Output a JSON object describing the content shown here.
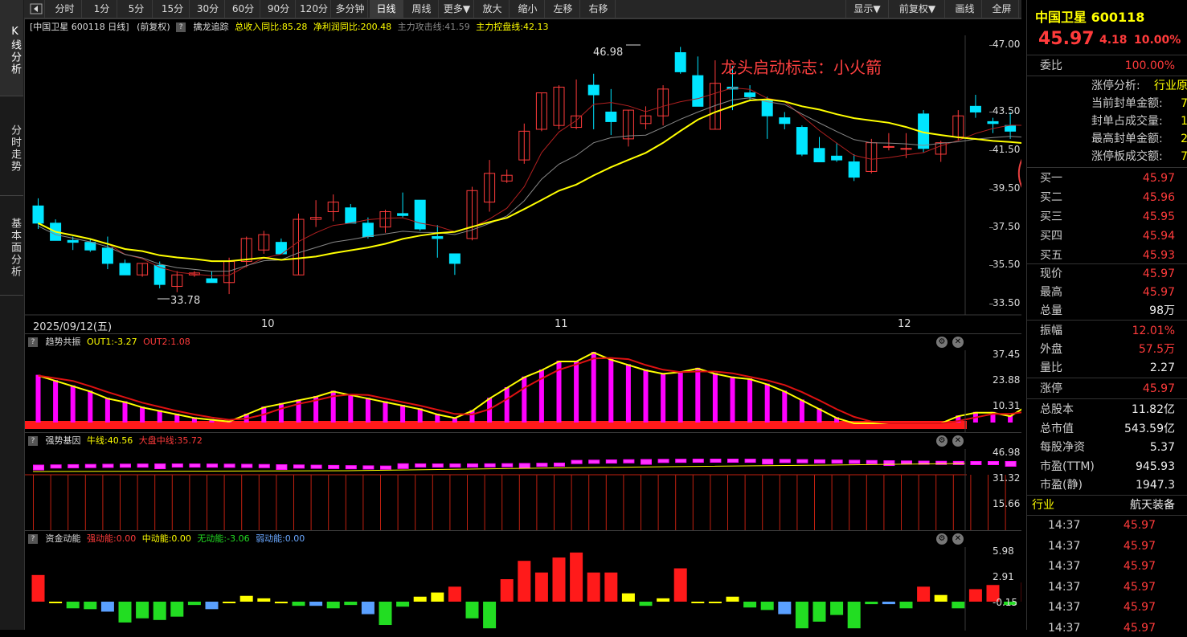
{
  "vtabs": [
    "K线分析",
    "分时走势",
    "基本面分析"
  ],
  "toolbar": {
    "back_icon": "back-arrow-icon",
    "buttons": [
      "分时",
      "1分",
      "5分",
      "15分",
      "30分",
      "60分",
      "90分",
      "120分",
      "多分钟",
      "日线",
      "周线",
      "更多▼",
      "放大",
      "缩小",
      "左移",
      "右移"
    ],
    "right_buttons": [
      "显示▼",
      "前复权▼",
      "画线",
      "全屏"
    ],
    "active": "日线"
  },
  "main": {
    "header": {
      "name": "[中国卫星 600118 日线]",
      "adj": "(前复权)",
      "indicator": "擒龙追踪",
      "items": [
        {
          "label": "总收入同比:85.28",
          "color": "#ffff00"
        },
        {
          "label": "净利润同比:200.48",
          "color": "#ffff00"
        },
        {
          "label": "主力攻击线:41.59",
          "color": "#888888"
        },
        {
          "label": "主力控盘线:42.13",
          "color": "#ffff00"
        }
      ]
    },
    "y_ticks": [
      "47.00",
      "43.50",
      "41.50",
      "39.50",
      "37.50",
      "35.50",
      "33.50"
    ],
    "x_labels": [
      "2025/09/12(五)",
      "10",
      "11",
      "12"
    ],
    "annotation": "龙头启动标志：小火箭",
    "high_label": "46.98",
    "low_label": "33.78",
    "rocket_icon": "rocket-icon"
  },
  "chart_data": [
    {
      "type": "candlestick",
      "title": "中国卫星 600118 日线",
      "ylim": [
        33.5,
        47.0
      ],
      "ohlc": [
        [
          38.6,
          39.0,
          37.4,
          37.7
        ],
        [
          37.7,
          37.9,
          36.8,
          36.8
        ],
        [
          36.8,
          37.0,
          36.3,
          36.7
        ],
        [
          36.7,
          36.9,
          36.2,
          36.3
        ],
        [
          36.4,
          37.0,
          35.3,
          35.6
        ],
        [
          35.6,
          35.8,
          35.0,
          35.0
        ],
        [
          35.0,
          35.6,
          34.9,
          35.6
        ],
        [
          35.5,
          35.7,
          34.3,
          34.5
        ],
        [
          34.4,
          35.2,
          34.1,
          35.0
        ],
        [
          35.0,
          35.2,
          34.9,
          35.1
        ],
        [
          34.8,
          35.2,
          34.6,
          34.6
        ],
        [
          34.6,
          35.9,
          34.0,
          35.7
        ],
        [
          35.7,
          37.0,
          35.4,
          36.9
        ],
        [
          36.3,
          37.3,
          36.1,
          37.1
        ],
        [
          36.7,
          36.9,
          36.1,
          36.1
        ],
        [
          35.0,
          38.2,
          35.0,
          37.9
        ],
        [
          37.9,
          38.9,
          37.5,
          38.0
        ],
        [
          38.3,
          39.2,
          37.8,
          38.8
        ],
        [
          38.5,
          38.7,
          37.7,
          37.7
        ],
        [
          37.7,
          38.0,
          36.9,
          37.0
        ],
        [
          37.5,
          38.4,
          37.2,
          38.3
        ],
        [
          38.2,
          39.3,
          38.0,
          38.1
        ],
        [
          38.9,
          38.9,
          37.3,
          37.4
        ],
        [
          37.0,
          37.6,
          35.9,
          36.9
        ],
        [
          36.1,
          36.1,
          35.0,
          35.6
        ],
        [
          36.9,
          39.6,
          36.8,
          39.4
        ],
        [
          38.8,
          41.0,
          38.3,
          40.3
        ],
        [
          39.9,
          40.5,
          39.8,
          40.2
        ],
        [
          41.0,
          42.9,
          40.8,
          42.5
        ],
        [
          42.6,
          44.5,
          42.5,
          44.5
        ],
        [
          42.8,
          44.9,
          42.6,
          44.8
        ],
        [
          42.7,
          45.2,
          42.6,
          43.3
        ],
        [
          44.9,
          45.5,
          42.6,
          44.4
        ],
        [
          43.5,
          44.7,
          42.3,
          43.0
        ],
        [
          42.1,
          43.6,
          41.7,
          43.6
        ],
        [
          42.9,
          43.8,
          42.6,
          43.3
        ],
        [
          43.3,
          44.9,
          42.8,
          44.7
        ],
        [
          46.6,
          46.9,
          45.5,
          45.6
        ],
        [
          45.4,
          46.4,
          43.8,
          43.8
        ],
        [
          42.6,
          46.2,
          42.6,
          45.0
        ],
        [
          44.8,
          45.9,
          43.6,
          44.7
        ],
        [
          44.5,
          44.9,
          44.1,
          44.3
        ],
        [
          44.1,
          44.3,
          42.1,
          43.3
        ],
        [
          43.2,
          43.5,
          42.6,
          42.9
        ],
        [
          42.7,
          42.8,
          41.2,
          41.3
        ],
        [
          41.6,
          42.2,
          40.9,
          40.9
        ],
        [
          41.2,
          41.9,
          40.9,
          41.0
        ],
        [
          40.9,
          41.3,
          39.9,
          40.1
        ],
        [
          40.4,
          42.1,
          40.3,
          41.9
        ],
        [
          41.7,
          42.4,
          41.5,
          41.7
        ],
        [
          41.6,
          42.4,
          41.1,
          41.6
        ],
        [
          43.4,
          43.6,
          41.4,
          41.6
        ],
        [
          41.3,
          42.0,
          40.9,
          41.9
        ],
        [
          42.2,
          43.6,
          42.0,
          43.3
        ],
        [
          43.8,
          44.4,
          43.2,
          43.5
        ],
        [
          43.0,
          43.2,
          42.4,
          42.9
        ],
        [
          42.8,
          43.5,
          42.1,
          42.5
        ],
        [
          41.7,
          43.8,
          41.0,
          41.8
        ]
      ],
      "lines": [
        {
          "name": "主力攻击线",
          "value": 41.59,
          "color": "#ff3b3b"
        },
        {
          "name": "主力控盘线",
          "value": 42.13,
          "color": "#ffff00"
        }
      ]
    },
    {
      "type": "bar",
      "title": "趋势共振",
      "series": [
        {
          "name": "OUT1",
          "value": -3.27
        },
        {
          "name": "OUT2",
          "value": 1.08
        }
      ],
      "values": [
        27,
        24,
        21,
        18,
        14,
        12,
        9,
        7,
        5,
        3,
        2,
        1,
        5,
        9,
        11,
        13,
        15,
        18,
        16,
        14,
        12,
        10,
        8,
        5,
        3,
        7,
        14,
        20,
        26,
        30,
        35,
        35,
        40,
        36,
        33,
        30,
        28,
        29,
        31,
        28,
        26,
        25,
        22,
        18,
        13,
        8,
        3,
        0,
        0,
        0,
        0,
        0,
        0,
        4,
        6,
        6,
        4,
        10
      ],
      "ylim": [
        0,
        40
      ],
      "y_ticks": [
        "37.45",
        "23.88",
        "10.31"
      ]
    },
    {
      "type": "bar",
      "title": "强势基因",
      "series": [
        {
          "name": "牛线",
          "value": 40.56
        },
        {
          "name": "大盘中线",
          "value": 35.72
        }
      ],
      "y_ticks": [
        "46.98",
        "31.32",
        "15.66"
      ]
    },
    {
      "type": "bar",
      "title": "资金动能",
      "series": [
        {
          "name": "强动能",
          "value": 0.0
        },
        {
          "name": "中动能",
          "value": 0.0
        },
        {
          "name": "无动能",
          "value": -3.06
        },
        {
          "name": "弱动能",
          "value": 0.0
        }
      ],
      "values": [
        3.2,
        -0.1,
        -0.8,
        -0.9,
        -1.2,
        -2.5,
        -2.0,
        -2.2,
        -1.8,
        -0.4,
        -0.9,
        -0.1,
        0.7,
        0.4,
        -0.2,
        -0.5,
        -0.5,
        -0.8,
        -0.4,
        -1.5,
        -2.8,
        -0.6,
        0.6,
        1.1,
        1.8,
        -2.0,
        -3.2,
        2.7,
        4.9,
        3.5,
        5.3,
        5.9,
        3.5,
        3.5,
        1.0,
        -0.5,
        0.4,
        4.0,
        -0.1,
        -0.1,
        0.6,
        -0.7,
        -1.0,
        -1.5,
        -3.2,
        -2.4,
        -1.6,
        -3.2,
        -0.3,
        -0.3,
        -0.8,
        1.8,
        0.8,
        -0.8,
        1.5,
        2.0,
        -0.4,
        2.3
      ],
      "ylim": [
        -0.15,
        5.98
      ],
      "y_ticks": [
        "5.98",
        "2.91",
        "-0.15"
      ]
    }
  ],
  "panel2": {
    "name": "趋势共振",
    "out1": "OUT1:-3.27",
    "out2": "OUT2:1.08"
  },
  "panel3": {
    "name": "强势基因",
    "l1": "牛线:40.56",
    "l2": "大盘中线:35.72"
  },
  "panel4": {
    "name": "资金动能",
    "l1": "强动能:0.00",
    "l2": "中动能:0.00",
    "l3": "无动能:-3.06",
    "l4": "弱动能:0.00"
  },
  "right": {
    "title": "中国卫星 600118",
    "price": "45.97",
    "change": "4.18",
    "pct": "10.00%",
    "weibi_l": "委比",
    "weibi_v": "100.00%",
    "limit_lines": [
      {
        "label": "涨停分析:",
        "value": "行业原"
      },
      {
        "label": "当前封单金额:",
        "value": "7"
      },
      {
        "label": "封单占成交量:",
        "value": "1"
      },
      {
        "label": "最高封单金额:",
        "value": "2"
      },
      {
        "label": "涨停板成交额:",
        "value": "7"
      }
    ],
    "bids": [
      {
        "l": "买一",
        "v": "45.97"
      },
      {
        "l": "买二",
        "v": "45.96"
      },
      {
        "l": "买三",
        "v": "45.95"
      },
      {
        "l": "买四",
        "v": "45.94"
      },
      {
        "l": "买五",
        "v": "45.93"
      }
    ],
    "quote": [
      {
        "l": "现价",
        "v": "45.97",
        "c": "red"
      },
      {
        "l": "最高",
        "v": "45.97",
        "c": "red"
      },
      {
        "l": "总量",
        "v": "98万",
        "c": "white"
      }
    ],
    "quote2": [
      {
        "l": "振幅",
        "v": "12.01%",
        "c": "red"
      },
      {
        "l": "外盘",
        "v": "57.5万",
        "c": "red"
      },
      {
        "l": "量比",
        "v": "2.27",
        "c": "white"
      }
    ],
    "zt": {
      "l": "涨停",
      "v": "45.97"
    },
    "fund": [
      {
        "l": "总股本",
        "v": "11.82亿"
      },
      {
        "l": "总市值",
        "v": "543.59亿"
      },
      {
        "l": "每股净资",
        "v": "5.37"
      },
      {
        "l": "市盈(TTM)",
        "v": "945.93"
      },
      {
        "l": "市盈(静)",
        "v": "1947.3"
      }
    ],
    "industry_l": "行业",
    "industry_v": "航天装备",
    "ticks": [
      {
        "t": "14:37",
        "p": "45.97"
      },
      {
        "t": "14:37",
        "p": "45.97"
      },
      {
        "t": "14:37",
        "p": "45.97"
      },
      {
        "t": "14:37",
        "p": "45.97"
      },
      {
        "t": "14:37",
        "p": "45.97"
      },
      {
        "t": "14:37",
        "p": "45.97"
      }
    ]
  }
}
